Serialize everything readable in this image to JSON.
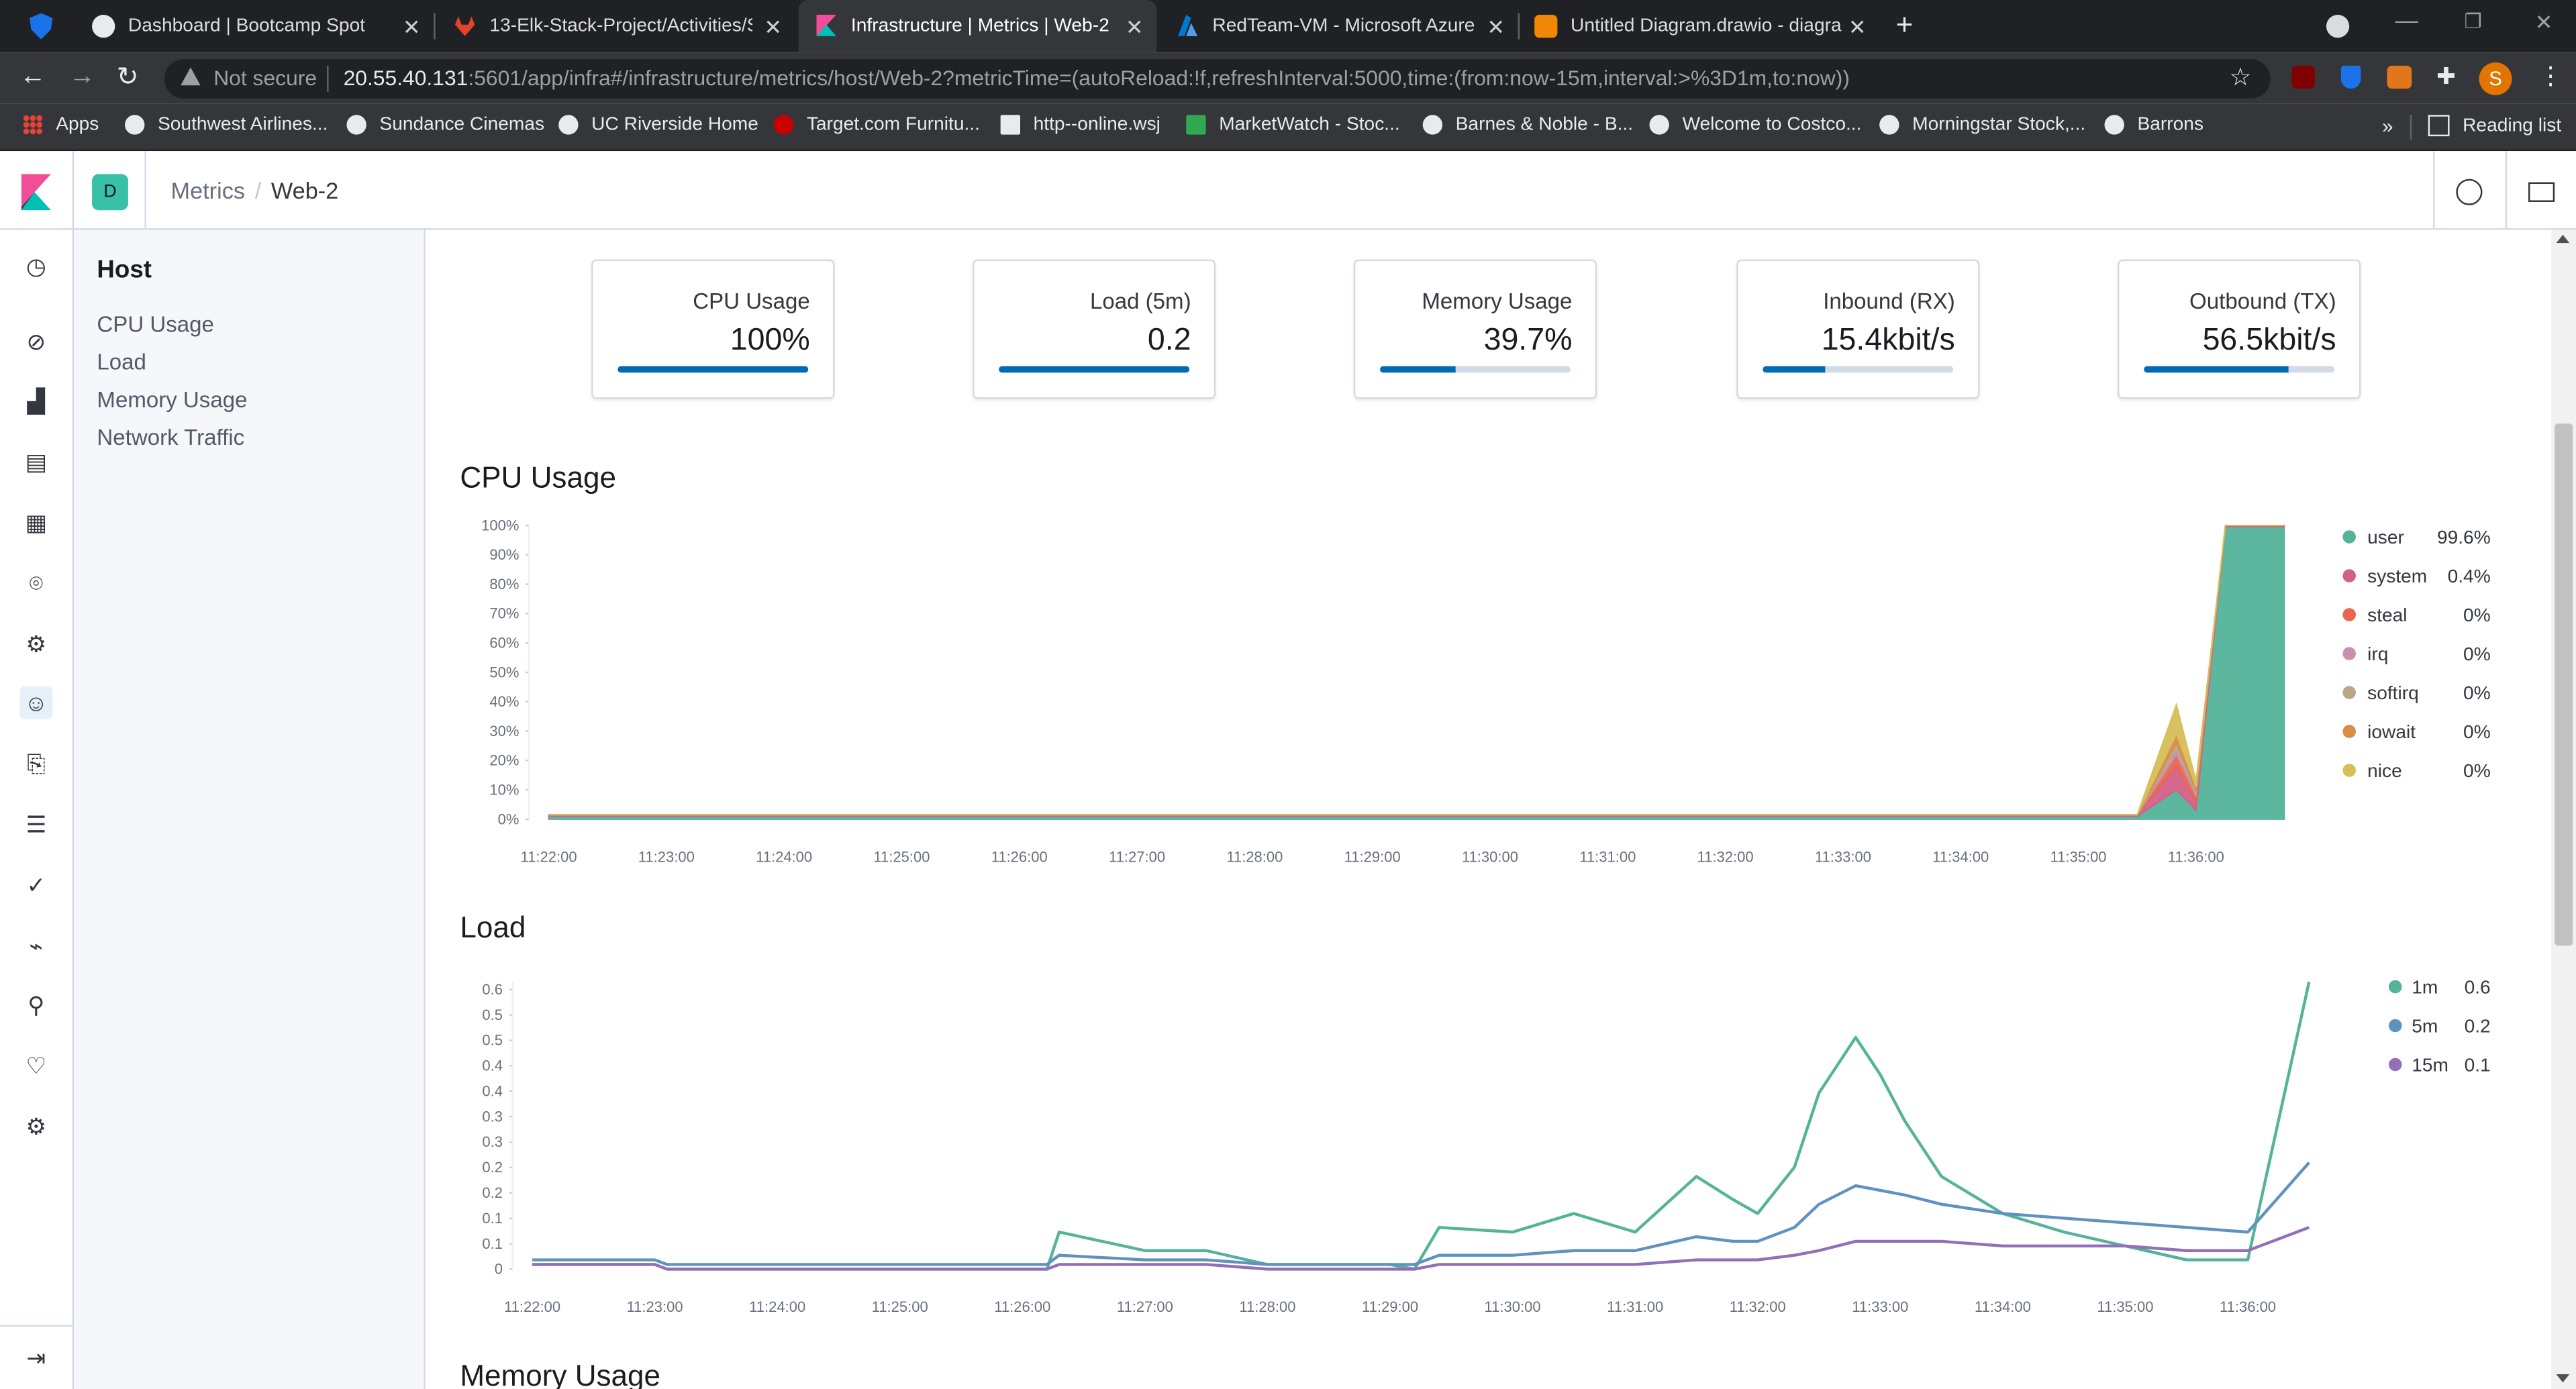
{
  "browser": {
    "tabs": [
      {
        "label": "Dashboard | Bootcamp Spot",
        "icon": "globe-icon",
        "color": "#e8eaed"
      },
      {
        "label": "13-Elk-Stack-Project/Activities/St",
        "icon": "gitlab-icon",
        "color": "#e24329"
      },
      {
        "label": "Infrastructure | Metrics | Web-2 -",
        "icon": "kibana-icon",
        "color": "#e8488b",
        "active": true
      },
      {
        "label": "RedTeam-VM - Microsoft Azure",
        "icon": "azure-icon",
        "color": "#0078d4"
      },
      {
        "label": "Untitled Diagram.drawio - diagra",
        "icon": "drawio-icon",
        "color": "#f08705"
      }
    ],
    "not_secure": "Not secure",
    "url_host": "20.55.40.131",
    "url_rest": ":5601/app/infra#/infrastructure/metrics/host/Web-2?metricTime=(autoReload:!f,refreshInterval:5000,time:(from:now-15m,interval:>%3D1m,to:now))",
    "profile_initial": "S",
    "bookmarks": [
      {
        "label": "Apps"
      },
      {
        "label": "Southwest Airlines..."
      },
      {
        "label": "Sundance Cinemas"
      },
      {
        "label": "UC Riverside Home"
      },
      {
        "label": "Target.com  Furnitu..."
      },
      {
        "label": "http--online.wsj"
      },
      {
        "label": "MarketWatch - Stoc..."
      },
      {
        "label": "Barnes & Noble - B..."
      },
      {
        "label": "Welcome to Costco..."
      },
      {
        "label": "Morningstar Stock,..."
      },
      {
        "label": "Barrons"
      }
    ],
    "reading_list": "Reading list"
  },
  "kibana": {
    "space_initial": "D",
    "breadcrumb": [
      "Metrics",
      "Web-2"
    ]
  },
  "sidenav": {
    "title": "Host",
    "items": [
      "CPU Usage",
      "Load",
      "Memory Usage",
      "Network Traffic"
    ]
  },
  "cards": [
    {
      "label": "CPU Usage",
      "value": "100%",
      "fill": 1.0
    },
    {
      "label": "Load (5m)",
      "value": "0.2",
      "fill": 1.0
    },
    {
      "label": "Memory Usage",
      "value": "39.7%",
      "fill": 0.397
    },
    {
      "label": "Inbound (RX)",
      "value": "15.4kbit/s",
      "fill": 0.33
    },
    {
      "label": "Outbound (TX)",
      "value": "56.5kbit/s",
      "fill": 0.76
    }
  ],
  "sections": {
    "cpu": "CPU Usage",
    "load": "Load",
    "memory": "Memory Usage"
  },
  "chart_data": [
    {
      "type": "area",
      "title": "CPU Usage",
      "x": [
        "11:22:00",
        "11:23:00",
        "11:24:00",
        "11:25:00",
        "11:26:00",
        "11:27:00",
        "11:28:00",
        "11:29:00",
        "11:30:00",
        "11:31:00",
        "11:32:00",
        "11:33:00",
        "11:34:00",
        "11:35:00",
        "11:35:30",
        "11:35:50",
        "11:36:00",
        "11:36:15",
        "11:36:45"
      ],
      "y_ticks": [
        "0%",
        "10%",
        "20%",
        "30%",
        "40%",
        "50%",
        "60%",
        "70%",
        "80%",
        "90%",
        "100%"
      ],
      "ylim": [
        0,
        100
      ],
      "series": [
        {
          "name": "user",
          "legend_value": "99.6%",
          "color": "#54b399",
          "values": [
            1,
            1,
            1,
            1,
            1,
            1,
            1,
            1,
            1,
            1,
            1,
            1,
            1,
            1,
            1,
            10,
            3,
            99.6,
            99.6
          ]
        },
        {
          "name": "system",
          "legend_value": "0.4%",
          "color": "#d36086",
          "values": [
            0.5,
            0.5,
            0.5,
            0.5,
            0.5,
            0.5,
            0.5,
            0.5,
            0.5,
            0.5,
            0.5,
            0.5,
            0.5,
            0.5,
            0.5,
            8,
            3,
            0.4,
            0.4
          ]
        },
        {
          "name": "steal",
          "legend_value": "0%",
          "color": "#e7664c",
          "values": [
            0,
            0,
            0,
            0,
            0,
            0,
            0,
            0,
            0,
            0,
            0,
            0,
            0,
            0,
            0,
            4,
            2,
            0,
            0
          ]
        },
        {
          "name": "irq",
          "legend_value": "0%",
          "color": "#ca8eae",
          "values": [
            0,
            0,
            0,
            0,
            0,
            0,
            0,
            0,
            0,
            0,
            0,
            0,
            0,
            0,
            0,
            2,
            1,
            0,
            0
          ]
        },
        {
          "name": "softirq",
          "legend_value": "0%",
          "color": "#b9a888",
          "values": [
            0,
            0,
            0,
            0,
            0,
            0,
            0,
            0,
            0,
            0,
            0,
            0,
            0,
            0,
            0,
            2,
            1,
            0,
            0
          ]
        },
        {
          "name": "iowait",
          "legend_value": "0%",
          "color": "#da8b45",
          "values": [
            0,
            0,
            0,
            0,
            0,
            0,
            0,
            0,
            0,
            0,
            0,
            0,
            0,
            0,
            0,
            3,
            1,
            0,
            0
          ]
        },
        {
          "name": "nice",
          "legend_value": "0%",
          "color": "#d6bf57",
          "values": [
            0,
            0,
            0,
            0,
            0,
            0,
            0,
            0,
            0,
            0,
            0,
            0,
            0,
            0,
            0,
            10,
            2,
            0,
            0
          ]
        }
      ]
    },
    {
      "type": "line",
      "title": "Load",
      "x_ticks": [
        "11:22:00",
        "11:23:00",
        "11:24:00",
        "11:25:00",
        "11:26:00",
        "11:27:00",
        "11:28:00",
        "11:29:00",
        "11:30:00",
        "11:31:00",
        "11:32:00",
        "11:33:00",
        "11:34:00",
        "11:35:00",
        "11:36:00"
      ],
      "y_ticks": [
        "0",
        "0.1",
        "0.1",
        "0.2",
        "0.2",
        "0.3",
        "0.3",
        "0.4",
        "0.4",
        "0.5",
        "0.5",
        "0.6"
      ],
      "ylim": [
        0,
        0.62
      ],
      "x_minutes": [
        0,
        1,
        1.1,
        2,
        3,
        3.5,
        4,
        4.2,
        4.3,
        5,
        5.5,
        6,
        7,
        7.2,
        7.4,
        8,
        8.5,
        9,
        9.5,
        9.8,
        10,
        10.3,
        10.5,
        10.8,
        11,
        11.2,
        11.5,
        12,
        12.5,
        13,
        13.5,
        14,
        14.5
      ],
      "series": [
        {
          "name": "1m",
          "legend_value": "0.6",
          "color": "#54b399",
          "values": [
            0.01,
            0.01,
            0,
            0,
            0,
            0,
            0,
            0,
            0.08,
            0.04,
            0.04,
            0.01,
            0.01,
            0.0,
            0.09,
            0.08,
            0.12,
            0.08,
            0.2,
            0.15,
            0.12,
            0.22,
            0.38,
            0.5,
            0.42,
            0.32,
            0.2,
            0.12,
            0.08,
            0.05,
            0.02,
            0.02,
            0.62
          ]
        },
        {
          "name": "5m",
          "legend_value": "0.2",
          "color": "#6092c0",
          "values": [
            0.02,
            0.02,
            0.01,
            0.01,
            0.01,
            0.01,
            0.01,
            0.01,
            0.03,
            0.02,
            0.02,
            0.01,
            0.01,
            0.01,
            0.03,
            0.03,
            0.04,
            0.04,
            0.07,
            0.06,
            0.06,
            0.09,
            0.14,
            0.18,
            0.17,
            0.16,
            0.14,
            0.12,
            0.11,
            0.1,
            0.09,
            0.08,
            0.23
          ]
        },
        {
          "name": "15m",
          "legend_value": "0.1",
          "color": "#9170b8",
          "values": [
            0.01,
            0.01,
            0,
            0,
            0,
            0,
            0,
            0,
            0.01,
            0.01,
            0.01,
            0,
            0,
            0,
            0.01,
            0.01,
            0.01,
            0.01,
            0.02,
            0.02,
            0.02,
            0.03,
            0.04,
            0.06,
            0.06,
            0.06,
            0.06,
            0.05,
            0.05,
            0.05,
            0.04,
            0.04,
            0.09
          ]
        }
      ]
    }
  ]
}
